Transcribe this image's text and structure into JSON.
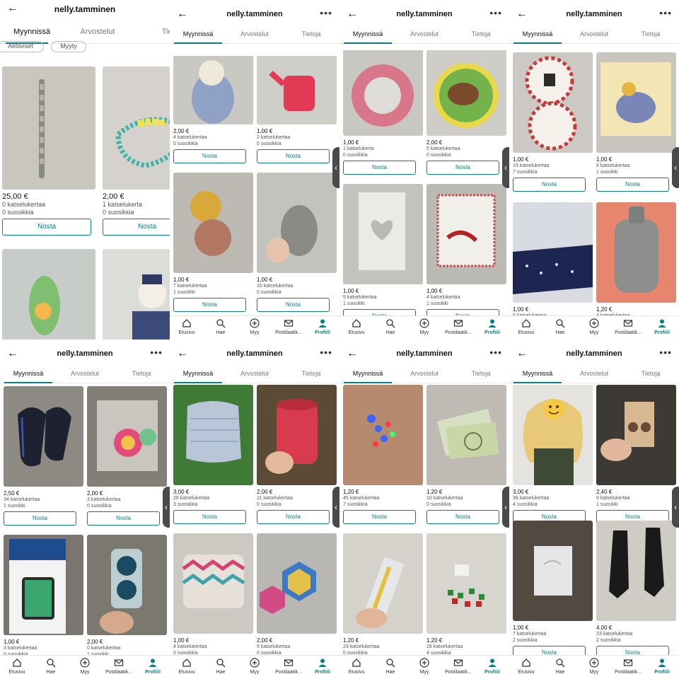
{
  "colors": {
    "accent": "#0a7c86",
    "handle": "#4a4a4a"
  },
  "header": {
    "title": "nelly.tamminen",
    "back_icon": "arrow-left-icon",
    "more_icon": "more-horizontal-icon"
  },
  "tabs": [
    "Myynnissä",
    "Arvostelut",
    "Tietoja"
  ],
  "filters": [
    "Aktiiviset",
    "Myyty"
  ],
  "nosta_label": "Nosta",
  "nav": [
    {
      "label": "Etusivu",
      "icon": "home-icon"
    },
    {
      "label": "Hae",
      "icon": "search-icon"
    },
    {
      "label": "Myy",
      "icon": "plus-circle-icon"
    },
    {
      "label": "Postilaatik...",
      "icon": "mail-icon"
    },
    {
      "label": "Profiili",
      "icon": "profile-icon"
    }
  ],
  "panels": [
    {
      "items": [
        {
          "price": "25,00 €",
          "views": "0 katselukertaa",
          "favs": "0 suosikkia",
          "desc": "metal bracelet"
        },
        {
          "price": "2,00 €",
          "views": "1 katselukerta",
          "favs": "0 suosikkia",
          "desc": "bead bracelet"
        },
        {
          "price": "",
          "views": "",
          "favs": "",
          "desc": "plush toy"
        },
        {
          "price": "",
          "views": "",
          "favs": "",
          "desc": "sailor plush"
        }
      ]
    },
    {
      "items": [
        {
          "price": "2,00 €",
          "views": "4 katselukertaa",
          "favs": "0 suosikkia",
          "desc": "plush bunny"
        },
        {
          "price": "1,00 €",
          "views": "2 katselukertaa",
          "favs": "0 suosikkia",
          "desc": "watering can"
        },
        {
          "price": "1,00 €",
          "views": "7 katselukertaa",
          "favs": "1 suosikki",
          "desc": "teether toys"
        },
        {
          "price": "1,00 €",
          "views": "10 katselukertaa",
          "favs": "0 suosikkia",
          "desc": "elephant comforter"
        }
      ]
    },
    {
      "items": [
        {
          "price": "1,00 €",
          "views": "1 katselukerta",
          "favs": "0 suosikkia",
          "desc": "pink ring"
        },
        {
          "price": "2,00 €",
          "views": "5 katselukertaa",
          "favs": "0 suosikkia",
          "desc": "horse plates"
        },
        {
          "price": "1,00 €",
          "views": "5 katselukertaa",
          "favs": "1 suosikki",
          "desc": "heart box"
        },
        {
          "price": "1,00 €",
          "views": "4 katselukertaa",
          "favs": "1 suosikki",
          "desc": "bag"
        }
      ]
    },
    {
      "items": [
        {
          "price": "1,00 €",
          "views": "19 katselukertaa",
          "favs": "7 suosikkia",
          "desc": "strawberry plates"
        },
        {
          "price": "1,00 €",
          "views": "6 katselukertaa",
          "favs": "1 suosikki",
          "desc": "eeyore book"
        },
        {
          "price": "1,00 €",
          "views": "5 katselukertaa",
          "favs": "",
          "desc": "bandanas"
        },
        {
          "price": "1,20 €",
          "views": "4 katselukertaa",
          "favs": "",
          "desc": "hot water bottle"
        }
      ]
    },
    {
      "items": [
        {
          "price": "2,50 €",
          "views": "34 katselukertaa",
          "favs": "1 suosikki",
          "desc": "watch straps"
        },
        {
          "price": "2,00 €",
          "views": "3 katselukertaa",
          "favs": "0 suosikkia",
          "desc": "stickers"
        },
        {
          "price": "1,00 €",
          "views": "3 katselukertaa",
          "favs": "0 suosikkia",
          "desc": "screen protector"
        },
        {
          "price": "2,00 €",
          "views": "0 katselukertaa",
          "favs": "1 suosikki",
          "desc": "blue ornaments"
        }
      ]
    },
    {
      "items": [
        {
          "price": "3,00 €",
          "views": "20 katselukertaa",
          "favs": "3 suosikkia",
          "desc": "pillow"
        },
        {
          "price": "2,00 €",
          "views": "11 katselukertaa",
          "favs": "0 suosikkia",
          "desc": "red tin"
        },
        {
          "price": "1,00 €",
          "views": "4 katselukertaa",
          "favs": "0 suosikkia",
          "desc": "fabric basket"
        },
        {
          "price": "2,00 €",
          "views": "9 katselukertaa",
          "favs": "0 suosikkia",
          "desc": "coasters"
        }
      ]
    },
    {
      "items": [
        {
          "price": "1,20 €",
          "views": "45 katselukertaa",
          "favs": "7 suosikkia",
          "desc": "led lights"
        },
        {
          "price": "1,20 €",
          "views": "10 katselukertaa",
          "favs": "0 suosikkia",
          "desc": "toy money"
        },
        {
          "price": "1,20 €",
          "views": "23 katselukertaa",
          "favs": "0 suosikkia",
          "desc": "pencils"
        },
        {
          "price": "1,20 €",
          "views": "28 katselukertaa",
          "favs": "4 suosikkia",
          "desc": "bead charms"
        }
      ]
    },
    {
      "items": [
        {
          "price": "3,00 €",
          "views": "36 katselukertaa",
          "favs": "4 suosikkia",
          "desc": "wig"
        },
        {
          "price": "2,40 €",
          "views": "9 katselukertaa",
          "favs": "1 suosikki",
          "desc": "earrings"
        },
        {
          "price": "1,00 €",
          "views": "7 katselukertaa",
          "favs": "2 suosikkia",
          "desc": "plastic bag"
        },
        {
          "price": "4,00 €",
          "views": "23 katselukertaa",
          "favs": "2 suosikkia",
          "desc": "black boots"
        }
      ]
    }
  ]
}
